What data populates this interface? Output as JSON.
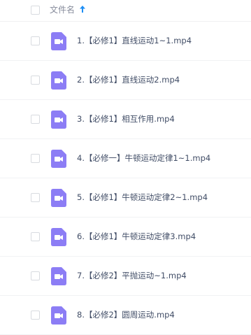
{
  "header": {
    "column_title": "文件名",
    "sort_icon": "arrow-up-icon"
  },
  "colors": {
    "accent": "#1d8ef5",
    "video_icon": "#8c7df5"
  },
  "files": [
    {
      "name": "1.【必修1】直线运动1~1.mp4",
      "icon": "video-file-icon"
    },
    {
      "name": "2.【必修1】直线运动2.mp4",
      "icon": "video-file-icon"
    },
    {
      "name": "3.【必修1】相互作用.mp4",
      "icon": "video-file-icon"
    },
    {
      "name": "4.【必修一】牛顿运动定律1~1.mp4",
      "icon": "video-file-icon"
    },
    {
      "name": "5.【必修1】牛顿运动定律2~1.mp4",
      "icon": "video-file-icon"
    },
    {
      "name": "6.【必修1】牛顿运动定律3.mp4",
      "icon": "video-file-icon"
    },
    {
      "name": "7.【必修2】平抛运动~1.mp4",
      "icon": "video-file-icon"
    },
    {
      "name": "8.【必修2】圆周运动.mp4",
      "icon": "video-file-icon"
    }
  ]
}
